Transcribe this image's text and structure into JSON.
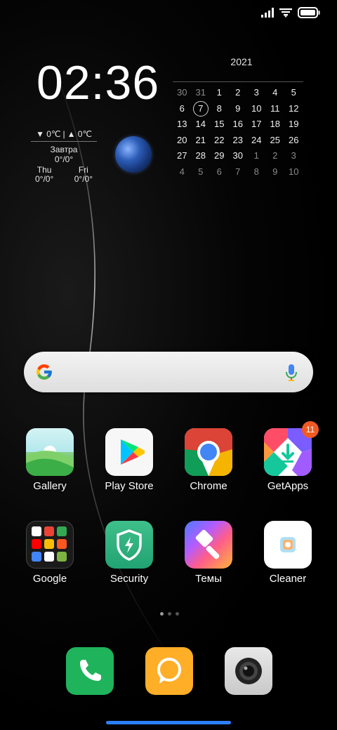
{
  "status_bar": {
    "signal": "signal-icon",
    "wifi": "wifi-icon",
    "battery": "battery-icon"
  },
  "clock": {
    "time": "02:36"
  },
  "weather": {
    "low": "▼ 0℃",
    "separator": "|",
    "high": "▲ 0℃",
    "tomorrow_label": "Завтра",
    "tomorrow_temp": "0°/0°",
    "forecast": [
      {
        "day": "Thu",
        "temp": "0°/0°"
      },
      {
        "day": "Fri",
        "temp": "0°/0°"
      }
    ]
  },
  "calendar": {
    "year": "2021",
    "today": "7",
    "weeks": [
      [
        {
          "d": "30",
          "m": true
        },
        {
          "d": "31",
          "m": true
        },
        {
          "d": "1"
        },
        {
          "d": "2"
        },
        {
          "d": "3"
        },
        {
          "d": "4"
        },
        {
          "d": "5"
        }
      ],
      [
        {
          "d": "6"
        },
        {
          "d": "7",
          "today": true
        },
        {
          "d": "8"
        },
        {
          "d": "9"
        },
        {
          "d": "10"
        },
        {
          "d": "11"
        },
        {
          "d": "12"
        }
      ],
      [
        {
          "d": "13"
        },
        {
          "d": "14"
        },
        {
          "d": "15"
        },
        {
          "d": "16"
        },
        {
          "d": "17"
        },
        {
          "d": "18"
        },
        {
          "d": "19"
        }
      ],
      [
        {
          "d": "20"
        },
        {
          "d": "21"
        },
        {
          "d": "22"
        },
        {
          "d": "23"
        },
        {
          "d": "24"
        },
        {
          "d": "25"
        },
        {
          "d": "26"
        }
      ],
      [
        {
          "d": "27"
        },
        {
          "d": "28"
        },
        {
          "d": "29"
        },
        {
          "d": "30"
        },
        {
          "d": "1",
          "m": true
        },
        {
          "d": "2",
          "m": true
        },
        {
          "d": "3",
          "m": true
        }
      ],
      [
        {
          "d": "4",
          "m": true
        },
        {
          "d": "5",
          "m": true
        },
        {
          "d": "6",
          "m": true
        },
        {
          "d": "7",
          "m": true
        },
        {
          "d": "8",
          "m": true
        },
        {
          "d": "9",
          "m": true
        },
        {
          "d": "10",
          "m": true
        }
      ]
    ]
  },
  "search": {
    "logo": "google-g-icon",
    "mic": "mic-icon"
  },
  "apps_row1": [
    {
      "label": "Gallery",
      "icon": "gallery-icon"
    },
    {
      "label": "Play Store",
      "icon": "play-store-icon"
    },
    {
      "label": "Chrome",
      "icon": "chrome-icon"
    },
    {
      "label": "GetApps",
      "icon": "getapps-icon",
      "badge": "11"
    }
  ],
  "apps_row2": [
    {
      "label": "Google",
      "icon": "google-folder-icon"
    },
    {
      "label": "Security",
      "icon": "security-icon"
    },
    {
      "label": "Темы",
      "icon": "themes-icon"
    },
    {
      "label": "Cleaner",
      "icon": "cleaner-icon"
    }
  ],
  "dock": [
    {
      "icon": "phone-icon",
      "color": "#1fb35b"
    },
    {
      "icon": "messaging-icon",
      "color": "#ffae27"
    },
    {
      "icon": "camera-icon",
      "color": "#d8d8d8"
    }
  ],
  "colors": {
    "nav_pill": "#2d7ff9",
    "badge": "#f05a24"
  }
}
